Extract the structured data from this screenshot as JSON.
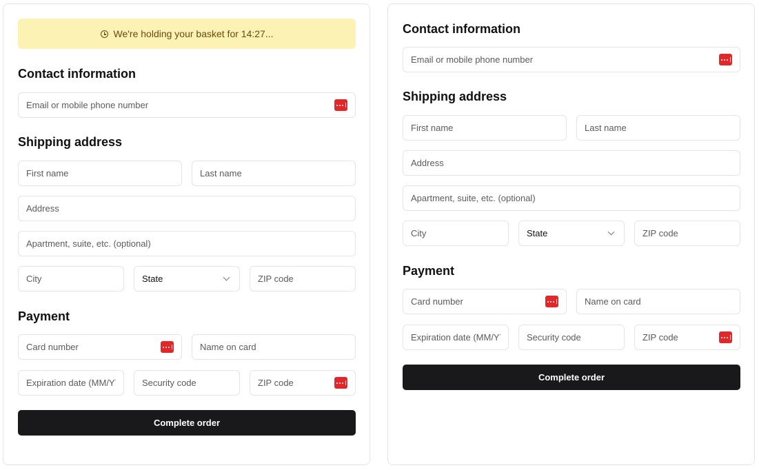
{
  "banner": {
    "text": "We're holding your basket for 14:27..."
  },
  "contact": {
    "heading": "Contact information",
    "email_placeholder": "Email or mobile phone number"
  },
  "shipping": {
    "heading": "Shipping address",
    "first_name_placeholder": "First name",
    "last_name_placeholder": "Last name",
    "address_placeholder": "Address",
    "apartment_placeholder": "Apartment, suite, etc. (optional)",
    "city_placeholder": "City",
    "state_value": "State",
    "zip_placeholder": "ZIP code"
  },
  "payment": {
    "heading": "Payment",
    "card_number_placeholder": "Card number",
    "name_on_card_placeholder": "Name on card",
    "expiration_placeholder": "Expiration date (MM/YY)",
    "security_code_placeholder": "Security code",
    "zip_placeholder": "ZIP code"
  },
  "submit": {
    "label": "Complete order"
  },
  "colors": {
    "banner_bg": "#fbf2b3",
    "banner_text": "#6b4a0a",
    "button_bg": "#19191b",
    "password_manager_icon": "#e0282a"
  }
}
